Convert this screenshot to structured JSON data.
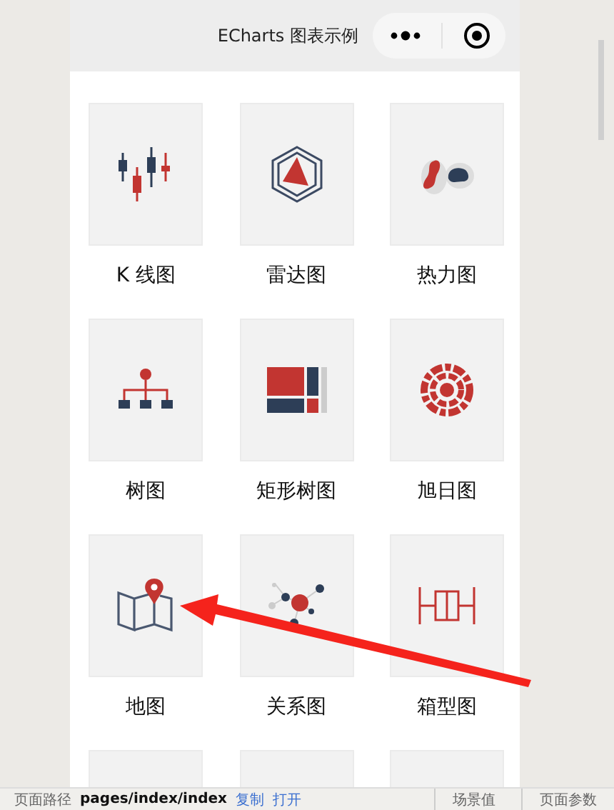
{
  "header": {
    "title": "ECharts 图表示例"
  },
  "charts": [
    {
      "label": "K 线图",
      "kind": "candlestick"
    },
    {
      "label": "雷达图",
      "kind": "radar"
    },
    {
      "label": "热力图",
      "kind": "heatmap"
    },
    {
      "label": "树图",
      "kind": "tree"
    },
    {
      "label": "矩形树图",
      "kind": "treemap"
    },
    {
      "label": "旭日图",
      "kind": "sunburst"
    },
    {
      "label": "地图",
      "kind": "map"
    },
    {
      "label": "关系图",
      "kind": "graph"
    },
    {
      "label": "箱型图",
      "kind": "boxplot"
    },
    {
      "kind": "blank"
    },
    {
      "kind": "blank"
    },
    {
      "kind": "blank"
    }
  ],
  "status_bar": {
    "path_label": "页面路径",
    "path": "pages/index/index",
    "copy": "复制",
    "open": "打开",
    "scene": "场景值",
    "params": "页面参数"
  }
}
